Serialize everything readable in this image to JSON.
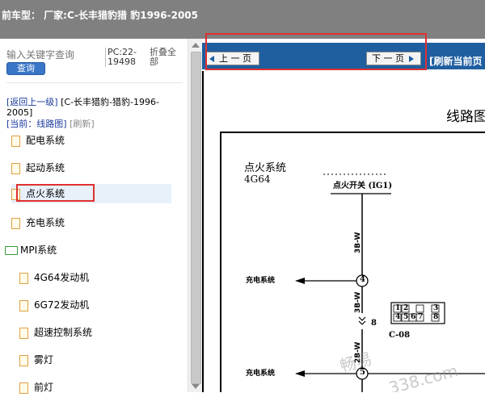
{
  "header": {
    "title": "前车型： 厂家:C-长丰猎豹猎 豹1996-2005"
  },
  "search": {
    "placeholder": "输入关键字查询",
    "button": "查询"
  },
  "pc_code": "PC:22-19498",
  "collapse_all": "折叠全部",
  "breadcrumb": {
    "back_link": "[返回上一级]",
    "path": "[C-长丰猎豹-猎豹-1996-2005]",
    "current_label": "[当前：线路图]",
    "refresh": "[刷新]"
  },
  "tree": {
    "items": [
      {
        "label": "配电系统",
        "type": "file"
      },
      {
        "label": "起动系统",
        "type": "file"
      },
      {
        "label": "点火系统",
        "type": "file",
        "active": true
      },
      {
        "label": "充电系统",
        "type": "file"
      },
      {
        "label": "MPI系统",
        "type": "folder"
      },
      {
        "label": "4G64发动机",
        "type": "file"
      },
      {
        "label": "6G72发动机",
        "type": "file"
      },
      {
        "label": "超速控制系统",
        "type": "file"
      },
      {
        "label": "雾灯",
        "type": "file"
      },
      {
        "label": "前灯",
        "type": "file"
      }
    ]
  },
  "viewer": {
    "prev_button": "上 一 页",
    "next_button": "下 一 页",
    "refresh_link": "[刷新当前页"
  },
  "diagram": {
    "page_title": "线路图",
    "system_title": "点火系统",
    "engine_code": "4G64",
    "switch_label": "点火开关 (IG1)",
    "wire_code_1": "3B-W",
    "wire_code_2": "3B-W",
    "wire_code_3": "2B-W",
    "charge_label_1": "充电系统",
    "charge_label_2": "充电系统",
    "pin_4": "4",
    "pin_8": "8",
    "pin_5": "5",
    "connector": "C-08",
    "connector_pins_top": [
      "1",
      "2",
      "",
      "3"
    ],
    "connector_pins_bottom": [
      "4",
      "5",
      "6",
      "7",
      "8"
    ]
  },
  "watermark": {
    "text_1": "畅易",
    "text_2": "338.com"
  },
  "colors": {
    "nav_blue": "#1f5fa0",
    "highlight_red": "#e03030",
    "header_gray": "#808080"
  }
}
